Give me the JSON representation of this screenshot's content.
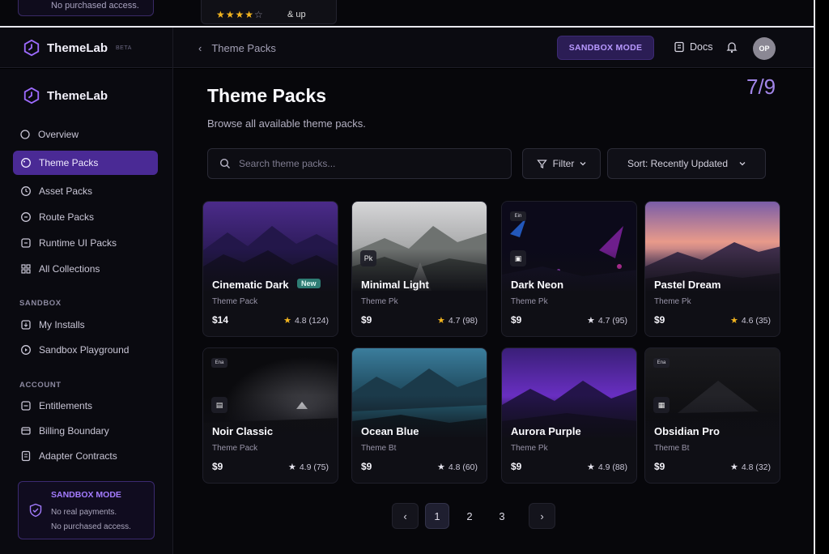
{
  "ghost": {
    "sidebar_text": "No purchased access.",
    "rating_stars": "★★★★",
    "rating_off_star": "☆",
    "rating_label": "& up"
  },
  "topbar": {
    "brand_name": "ThemeLab",
    "brand_tag": "BETA",
    "back_arrow": "‹",
    "back_label": "Theme Packs",
    "mode_label": "SANDBOX MODE",
    "docs_label": "Docs",
    "avatar_initials": "OP"
  },
  "sidebar": {
    "brand_name": "ThemeLab",
    "overview": "Overview",
    "items": [
      {
        "label": "Theme Packs",
        "icon": "palette-icon",
        "active": true
      },
      {
        "label": "Asset Packs",
        "icon": "asset-icon"
      },
      {
        "label": "Route Packs",
        "icon": "route-icon"
      },
      {
        "label": "Runtime UI Packs",
        "icon": "runtime-icon"
      },
      {
        "label": "All Collections",
        "icon": "grid-icon"
      }
    ],
    "sections": [
      {
        "label": "SANDBOX",
        "items": [
          "My Installs",
          "Sandbox Playground"
        ]
      },
      {
        "label": "ACCOUNT",
        "items": [
          "Entitlements",
          "Billing Boundary",
          "Adapter Contracts"
        ]
      }
    ],
    "sandbox_box": {
      "title": "SANDBOX MODE",
      "line1": "No real payments.",
      "line2": "No purchased access."
    }
  },
  "main": {
    "title": "Theme Packs",
    "subtitle": "Browse all available theme packs.",
    "counter": "7/9",
    "search_placeholder": "Search theme packs...",
    "filter_label": "Filter",
    "sort_label": "Sort: Recently Updated",
    "cards": [
      {
        "name": "Cinematic Dark",
        "type": "Theme Pack",
        "price": "$14",
        "rating": "4.8 (124)",
        "badge": "New",
        "star_color": "#f3b51f"
      },
      {
        "name": "Minimal Light",
        "type": "Theme Pk",
        "price": "$9",
        "rating": "4.7 (98)",
        "star_color": "#f3b51f",
        "tag": "Pk"
      },
      {
        "name": "Dark Neon",
        "type": "Theme Pk",
        "price": "$9",
        "rating": "4.7 (95)",
        "star_color": "#e6e4ee",
        "tag": "Ein"
      },
      {
        "name": "Pastel Dream",
        "type": "Theme Pk",
        "price": "$9",
        "rating": "4.6 (35)",
        "star_color": "#f3b51f"
      },
      {
        "name": "Noir Classic",
        "type": "Theme Pack",
        "price": "$9",
        "rating": "4.9 (75)",
        "star_color": "#e6e4ee",
        "tag": "Ena"
      },
      {
        "name": "Ocean Blue",
        "type": "Theme Bt",
        "price": "$9",
        "rating": "4.8 (60)",
        "star_color": "#e6e4ee"
      },
      {
        "name": "Aurora Purple",
        "type": "Theme Pk",
        "price": "$9",
        "rating": "4.9 (88)",
        "star_color": "#e6e4ee"
      },
      {
        "name": "Obsidian Pro",
        "type": "Theme Bt",
        "price": "$9",
        "rating": "4.8 (32)",
        "star_color": "#e6e4ee",
        "tag": "Ena"
      }
    ],
    "pagination": {
      "prev": "‹",
      "pages": [
        "1",
        "2",
        "3"
      ],
      "current": "1",
      "next": "›"
    }
  },
  "colors": {
    "accent": "#4a2a95",
    "accent_text": "#a47cff",
    "star": "#f3b51f"
  }
}
